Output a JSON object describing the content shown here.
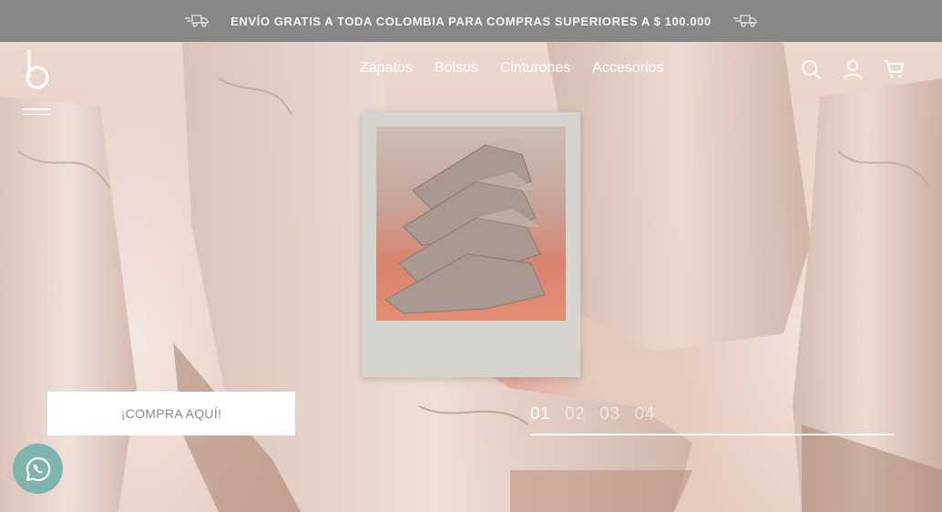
{
  "promo": {
    "text": "ENVÍO GRATIS A TODA COLOMBIA PARA COMPRAS SUPERIORES A $ 100.000",
    "icon": "delivery-truck-icon"
  },
  "brand": {
    "logo_icon": "b-logo-icon"
  },
  "nav": {
    "items": [
      {
        "label": "Zapatos"
      },
      {
        "label": "Bolsos"
      },
      {
        "label": "Cinturones"
      },
      {
        "label": "Accesorios"
      }
    ],
    "icons": [
      "search-icon",
      "user-icon",
      "cart-icon"
    ]
  },
  "hero": {
    "cta_label": "¡COMPRA AQUÍ!",
    "slides": [
      "01",
      "02",
      "03",
      "04"
    ],
    "active_slide": "01",
    "slide_progress": 0.25
  },
  "whatsapp": {
    "icon": "whatsapp-icon"
  },
  "colors": {
    "promo_bg": "#878787",
    "hero_bg": "#e9d2c6",
    "whatsapp": "#7fb4ae",
    "white": "#ffffff"
  }
}
